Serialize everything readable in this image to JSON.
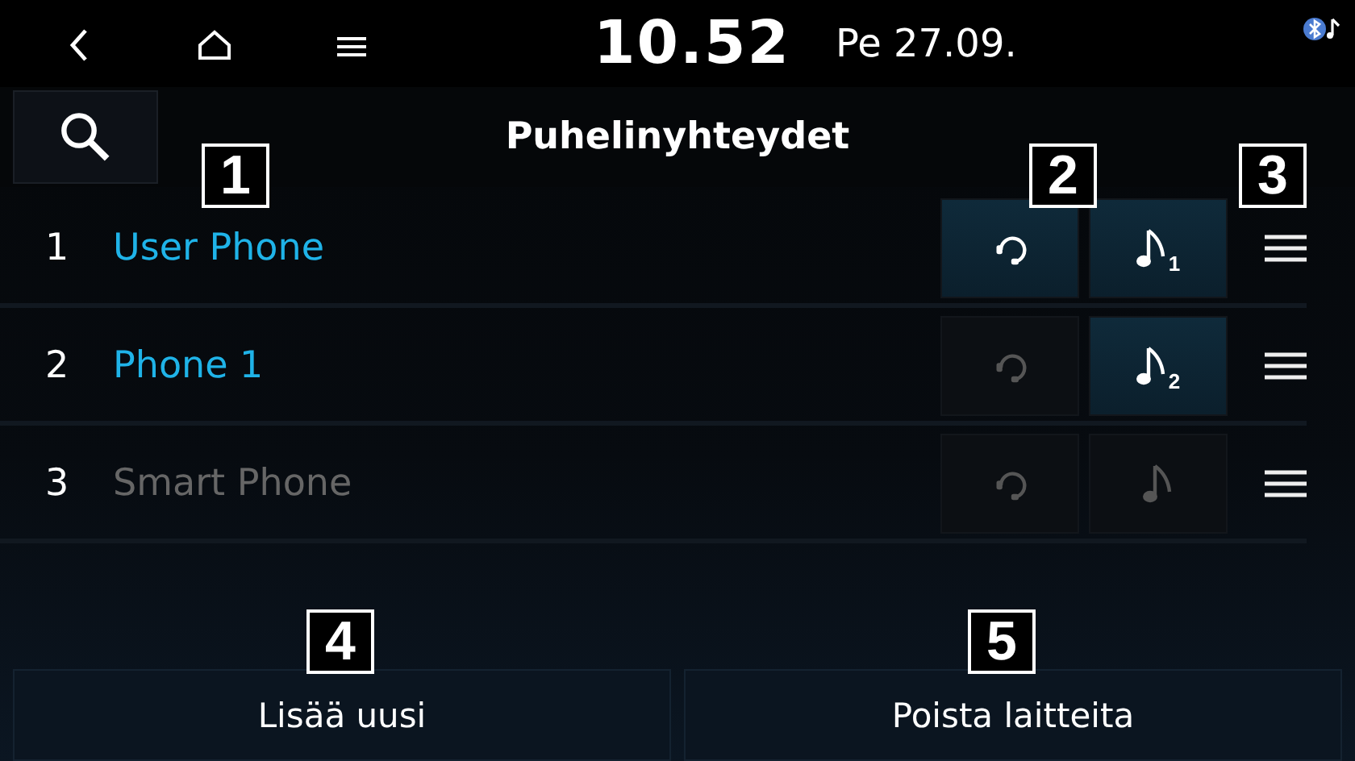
{
  "status_bar": {
    "time": "10.52",
    "date": "Pe 27.09."
  },
  "header": {
    "title": "Puhelinyhteydet"
  },
  "devices": [
    {
      "index": "1",
      "name": "User Phone",
      "connected": true,
      "handsfree": true,
      "audio": true,
      "audio_badge": "1"
    },
    {
      "index": "2",
      "name": "Phone 1",
      "connected": true,
      "handsfree": false,
      "audio": true,
      "audio_badge": "2"
    },
    {
      "index": "3",
      "name": "Smart Phone",
      "connected": false,
      "handsfree": false,
      "audio": false
    }
  ],
  "buttons": [
    "Lisää uusi",
    "Poista laitteita"
  ],
  "callouts": [
    "1",
    "2",
    "3",
    "4",
    "5"
  ]
}
